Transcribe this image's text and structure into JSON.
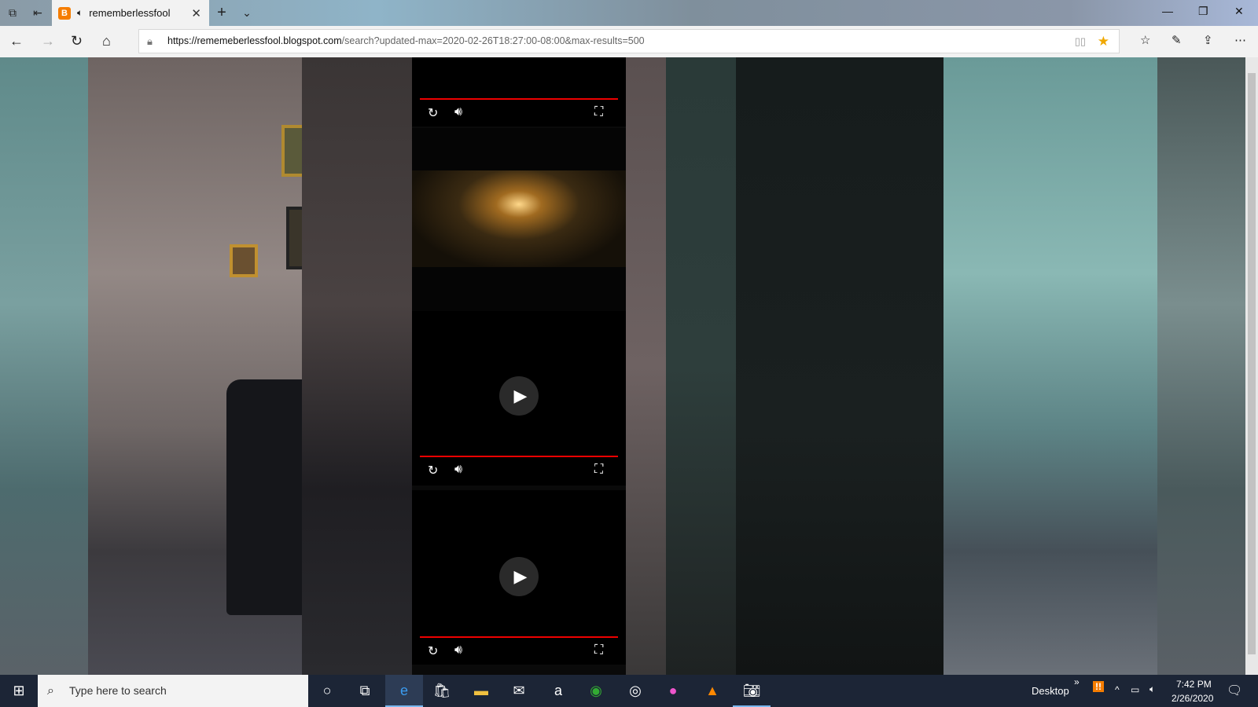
{
  "browser": {
    "tab": {
      "title": "rememberlessfool",
      "favicon": "B",
      "audio_icon": "speaker-icon"
    },
    "new_tab": "+",
    "tab_menu": "⌄",
    "url_host": "https://rememeberlessfool.blogspot.com",
    "url_path": "/search?updated-max=2020-02-26T18:27:00-08:00&max-results=500",
    "favorite_starred": true,
    "window_controls": {
      "minimize": "—",
      "restore": "❐",
      "close": "✕"
    }
  },
  "videos": [
    {
      "state": "controls-visible",
      "progress": 0,
      "has_play_button": false
    },
    {
      "state": "thumbnail"
    },
    {
      "state": "paused",
      "progress": 0,
      "play_icon": "▶"
    },
    {
      "state": "paused",
      "progress": 0,
      "play_icon": "▶"
    }
  ],
  "colors": {
    "accent_progress": "#ee0000",
    "taskbar": "#1c2536",
    "blogger": "#f57d00"
  },
  "taskbar": {
    "search_placeholder": "Type here to search",
    "desktop_label": "Desktop",
    "time": "7:42 PM",
    "date": "2/26/2020"
  }
}
